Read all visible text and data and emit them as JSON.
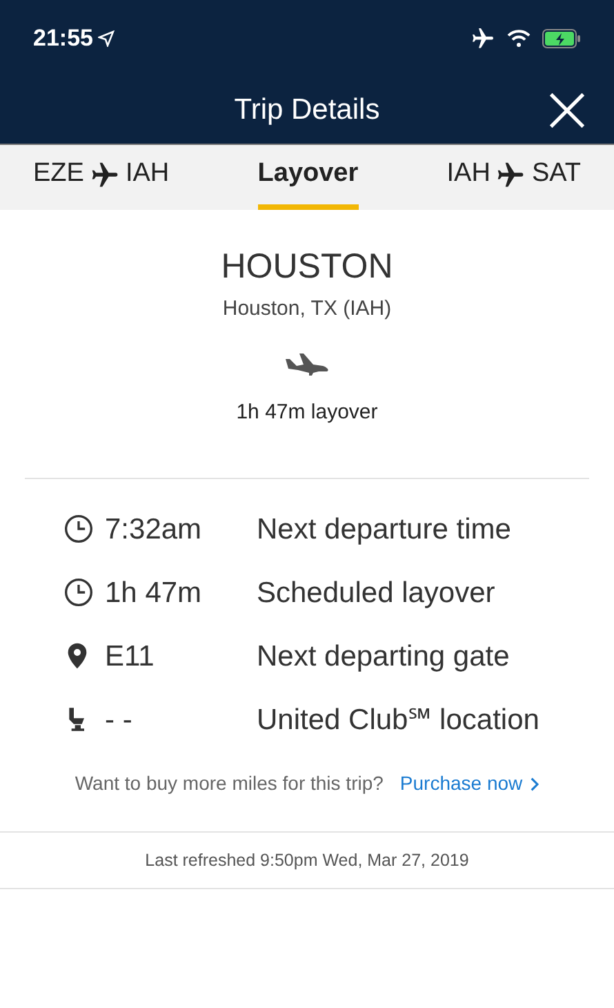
{
  "status_bar": {
    "time": "21:55"
  },
  "header": {
    "title": "Trip Details"
  },
  "tabs": [
    {
      "kind": "route",
      "from": "EZE",
      "to": "IAH",
      "selected": false
    },
    {
      "kind": "label",
      "label": "Layover",
      "selected": true
    },
    {
      "kind": "route",
      "from": "IAH",
      "to": "SAT",
      "selected": false
    }
  ],
  "city": {
    "name": "HOUSTON",
    "airport": "Houston, TX (IAH)",
    "layover": "1h 47m layover"
  },
  "details": [
    {
      "kind": "clock",
      "value": "7:32am",
      "label": "Next departure time"
    },
    {
      "kind": "clock",
      "value": "1h 47m",
      "label": "Scheduled layover"
    },
    {
      "kind": "pin",
      "value": "E11",
      "label": "Next departing gate"
    },
    {
      "kind": "seat",
      "value": "- -",
      "label": "United Club℠ location"
    }
  ],
  "promo": {
    "text": "Want to buy more miles for this trip?",
    "link": "Purchase now"
  },
  "footer": {
    "refreshed": "Last refreshed 9:50pm Wed, Mar 27, 2019"
  }
}
